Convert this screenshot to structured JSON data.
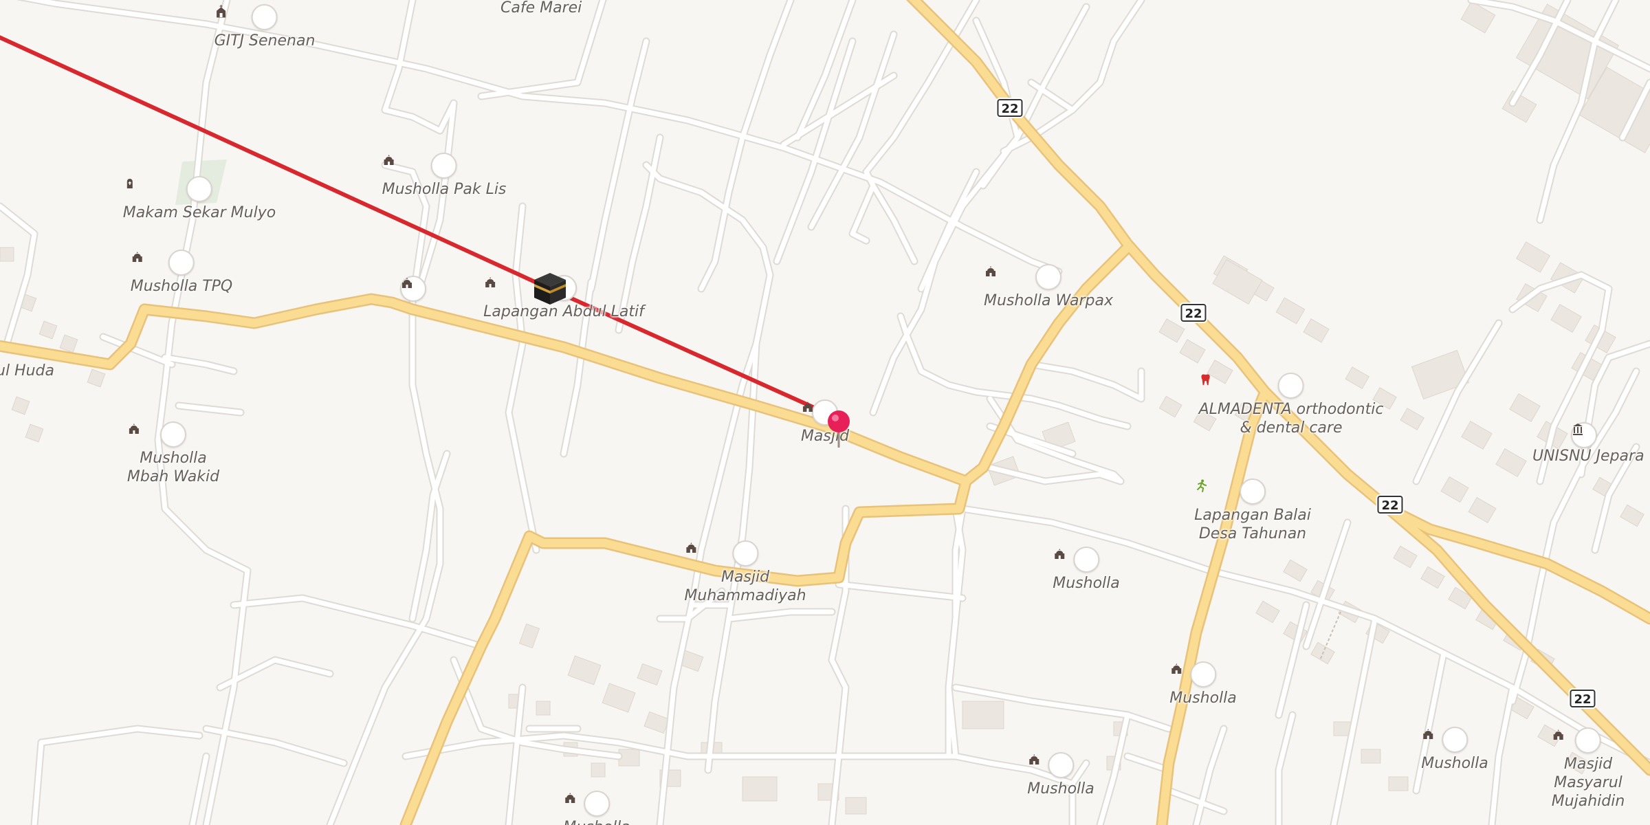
{
  "map": {
    "route_color": "#d9272e",
    "road_major_color": "#f7d58a",
    "road_minor_color": "#ffffff",
    "building_color": "#ebe6df",
    "pin_color": "#e8205a"
  },
  "highway_shields": [
    "22",
    "22",
    "22",
    "22"
  ],
  "pois": {
    "gitj_senenan": {
      "label": "GITJ Senenan",
      "icon": "church-icon"
    },
    "cafe_marei": {
      "label": "Cafe Marei"
    },
    "musholla_pak_lis": {
      "label": "Musholla Pak Lis",
      "icon": "mosque-icon"
    },
    "makam_sekar_mulyo": {
      "label": "Makam Sekar Mulyo",
      "icon": "cemetery-icon"
    },
    "musholla_tpq": {
      "label": "Musholla TPQ",
      "icon": "mosque-icon"
    },
    "lapangan_abdul_latif": {
      "label": "Lapangan Abdul Latif",
      "icon": "mosque-icon"
    },
    "ul_huda": {
      "label": "ul Huda"
    },
    "musholla_mbah_wakid": {
      "label": "Musholla\nMbah Wakid",
      "icon": "mosque-icon"
    },
    "masjid": {
      "label": "Masjid",
      "icon": "mosque-icon"
    },
    "musholla_warpax": {
      "label": "Musholla Warpax",
      "icon": "mosque-icon"
    },
    "almadenta": {
      "label": "ALMADENTA orthodontic\n& dental care",
      "icon": "tooth-icon"
    },
    "unisnu": {
      "label": "UNISNU Jepara",
      "icon": "university-icon"
    },
    "lapangan_balai": {
      "label": "Lapangan Balai\nDesa Tahunan",
      "icon": "sports-icon"
    },
    "masjid_muhammadiyah": {
      "label": "Masjid\nMuhammadiyah",
      "icon": "mosque-icon"
    },
    "musholla_1": {
      "label": "Musholla",
      "icon": "mosque-icon"
    },
    "musholla_2": {
      "label": "Musholla",
      "icon": "mosque-icon"
    },
    "musholla_3": {
      "label": "Musholla",
      "icon": "mosque-icon"
    },
    "musholla_4": {
      "label": "Musholla",
      "icon": "mosque-icon"
    },
    "musholla_5": {
      "label": "Musholla",
      "icon": "mosque-icon"
    },
    "masjid_masyarul": {
      "label": "Masjid Masyarul\nMujahidin",
      "icon": "mosque-icon"
    }
  }
}
